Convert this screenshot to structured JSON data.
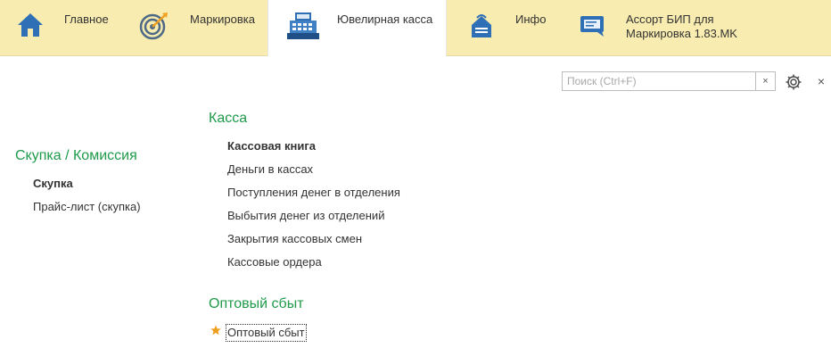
{
  "sections": [
    {
      "label": "Главное",
      "icon": "home-icon",
      "active": false
    },
    {
      "label": "Маркировка",
      "icon": "target-icon",
      "active": false
    },
    {
      "label": "Ювелирная касса",
      "icon": "cash-register-icon",
      "active": true
    },
    {
      "label": "Инфо",
      "icon": "info-bag-icon",
      "active": false
    },
    {
      "label": "Ассорт БИП для\nМаркировка 1.83.MK",
      "icon": "chat-icon",
      "active": false
    }
  ],
  "search": {
    "placeholder": "Поиск (Ctrl+F)",
    "value": "",
    "clear_label": "×"
  },
  "close_label": "×",
  "left_group": {
    "title": "Скупка / Комиссия",
    "items": [
      "Скупка",
      "Прайс-лист (скупка)"
    ]
  },
  "kassa_group": {
    "title": "Касса",
    "items": [
      "Кассовая книга",
      "Деньги в кассах",
      "Поступления денег в отделения",
      "Выбытия денег из отделений",
      "Закрытия кассовых смен",
      "Кассовые ордера"
    ]
  },
  "opt_group": {
    "title": "Оптовый сбыт",
    "items": [
      "Оптовый сбыт"
    ]
  },
  "colors": {
    "panel": "#f8ecb0",
    "group_title": "#1f9a4a",
    "icon_blue": "#2e6fb5",
    "star": "#f0a020"
  }
}
